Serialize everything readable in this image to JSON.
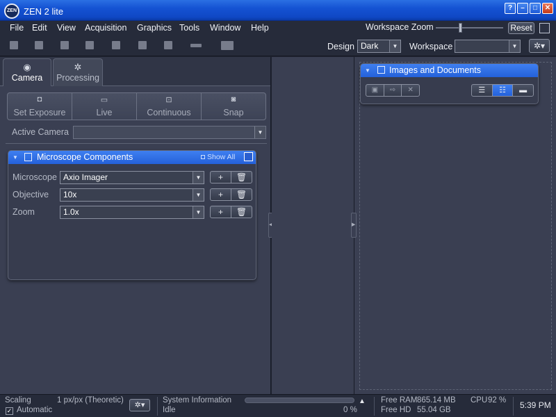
{
  "window": {
    "logo_text": "ZEN",
    "title": "ZEN 2 lite",
    "buttons": [
      "?",
      "–",
      "□",
      "✕"
    ]
  },
  "menu": {
    "items": [
      "File",
      "Edit",
      "View",
      "Acquisition",
      "Graphics",
      "Tools",
      "Window",
      "Help"
    ],
    "workspace_zoom_label": "Workspace Zoom",
    "reset_label": "Reset"
  },
  "toolbar": {
    "icons": [
      "new-icon",
      "open-icon",
      "save-icon",
      "search-doc-icon",
      "cut-icon",
      "copy-icon",
      "paste-icon",
      "ruler-icon",
      "image-icon"
    ],
    "design_label": "Design",
    "design_value": "Dark",
    "workspace_label": "Workspace",
    "workspace_value": ""
  },
  "left_panel": {
    "tabs": [
      {
        "label": "Camera",
        "icon": "eye-icon"
      },
      {
        "label": "Processing",
        "icon": "gear-icon"
      }
    ],
    "acquisition_buttons": [
      {
        "label": "Set Exposure",
        "icon": "camera-icon"
      },
      {
        "label": "Live",
        "icon": "live-icon"
      },
      {
        "label": "Continuous",
        "icon": "continuous-icon"
      },
      {
        "label": "Snap",
        "icon": "snap-icon"
      }
    ],
    "active_camera_label": "Active Camera",
    "active_camera_value": "",
    "microscope_group": {
      "title": "Microscope Components",
      "show_all_label": "Show All",
      "rows": [
        {
          "label": "Microscope",
          "value": "Axio Imager"
        },
        {
          "label": "Objective",
          "value": "10x"
        },
        {
          "label": "Zoom",
          "value": "1.0x"
        }
      ],
      "add_symbol": "+",
      "delete_symbol": "🗑"
    }
  },
  "right_panel": {
    "docs_group": {
      "title": "Images and Documents"
    }
  },
  "statusbar": {
    "scaling_label": "Scaling",
    "scaling_value": "1 px/px (Theoretic)",
    "automatic_label": "Automatic",
    "system_info_label": "System Information",
    "status_value": "Idle",
    "progress_text": "0 %",
    "progress": 0,
    "ram_label": "Free RAM",
    "ram_value": "865.14 MB",
    "hd_label": "Free HD",
    "hd_value": "55.04 GB",
    "cpu_label": "CPU",
    "cpu_value": "92 %",
    "time": "5:39 PM"
  }
}
